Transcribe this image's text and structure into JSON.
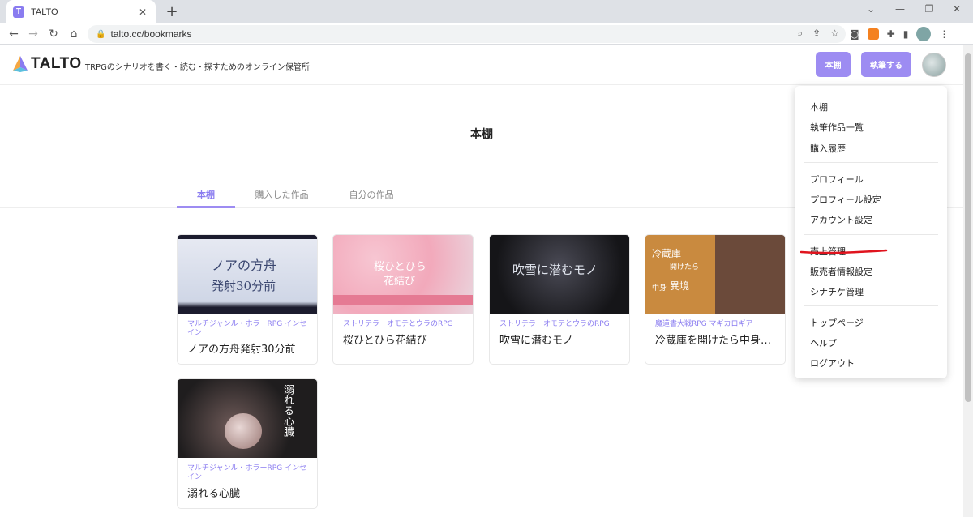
{
  "browser": {
    "tab_title": "TALTO",
    "tab_favicon_letter": "T",
    "url": "talto.cc/bookmarks"
  },
  "site": {
    "logo_text": "TALTO",
    "tagline": "TRPGのシナリオを書く・読む・探すためのオンライン保管所",
    "bookshelf_button": "本棚",
    "write_button": "執筆する",
    "accent_color": "#9d8cf2"
  },
  "page": {
    "title": "本棚",
    "tabs": [
      {
        "label": "本棚",
        "active": true
      },
      {
        "label": "購入した作品",
        "active": false
      },
      {
        "label": "自分の作品",
        "active": false
      }
    ]
  },
  "cards": [
    {
      "genre": "マルチジャンル・ホラーRPG インセイン",
      "title": "ノアの方舟発射30分前",
      "image_text": [
        "ノアの方舟",
        "発射30分前"
      ]
    },
    {
      "genre": "ストリテラ　オモテとウラのRPG",
      "title": "桜ひとひら花結び",
      "image_text": [
        "桜ひとひら",
        "花結び"
      ]
    },
    {
      "genre": "ストリテラ　オモテとウラのRPG",
      "title": "吹雪に潜むモノ",
      "image_text": [
        "吹雪に潜むモノ"
      ]
    },
    {
      "genre": "魔道書大戦RPG マギカロギア",
      "title": "冷蔵庫を開けたら中身…",
      "image_text": [
        "冷蔵庫",
        "開けたら",
        "中身",
        "異境"
      ]
    },
    {
      "genre": "マルチジャンル・ホラーRPG インセイン",
      "title": "溺れる心臓",
      "image_text": [
        "溺れる心臓"
      ]
    }
  ],
  "menu": {
    "groups": [
      [
        "本棚",
        "執筆作品一覧",
        "購入履歴"
      ],
      [
        "プロフィール",
        "プロフィール設定",
        "アカウント設定"
      ],
      [
        "売上管理",
        "販売者情報設定",
        "シナチケ管理"
      ],
      [
        "トップページ",
        "ヘルプ",
        "ログアウト"
      ]
    ]
  }
}
